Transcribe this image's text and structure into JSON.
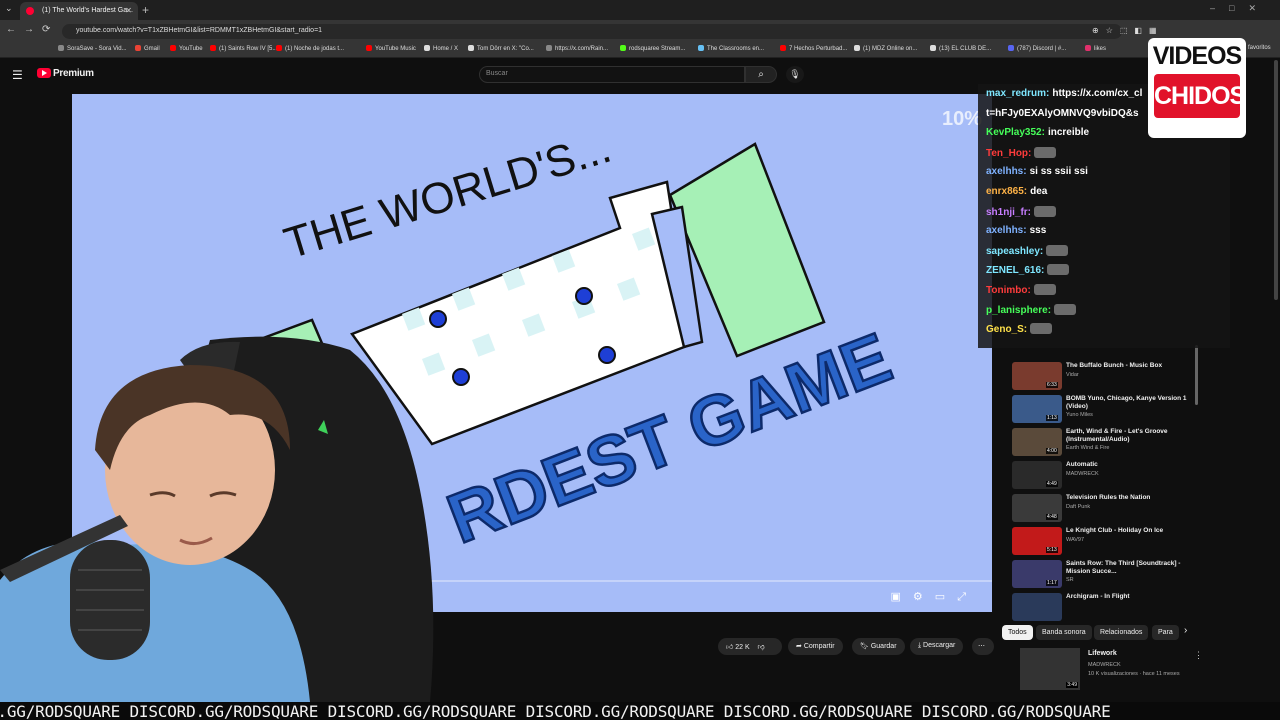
{
  "browser": {
    "tab_title": "(1) The World's Hardest Ga...",
    "url": "youtube.com/watch?v=T1xZBHetmGI&list=RDMMT1xZBHetmGI&start_radio=1",
    "bookmarks": [
      {
        "label": "SoraSave - Sora Vid...",
        "color": "#888888"
      },
      {
        "label": "Gmail",
        "color": "#ea4335"
      },
      {
        "label": "YouTube",
        "color": "#ff0000"
      },
      {
        "label": "(1) Saints Row IV [5...",
        "color": "#ff0000"
      },
      {
        "label": "(1) Noche de jodas t...",
        "color": "#ff0000"
      },
      {
        "label": "YouTube Music",
        "color": "#ff0000"
      },
      {
        "label": "Home / X",
        "color": "#dddddd"
      },
      {
        "label": "Tom Dörr en X: \"Co...",
        "color": "#dddddd"
      },
      {
        "label": "https://x.com/Rain...",
        "color": "#888888"
      },
      {
        "label": "rodsquaree Stream...",
        "color": "#53fc18"
      },
      {
        "label": "The Classrooms en...",
        "color": "#66c0f4"
      },
      {
        "label": "7 Hechos Perturbad...",
        "color": "#ff0000"
      },
      {
        "label": "(1) MDZ Online on...",
        "color": "#dddddd"
      },
      {
        "label": "(13) EL CLUB DE...",
        "color": "#dddddd"
      },
      {
        "label": "(787) Discord | #...",
        "color": "#5865f2"
      },
      {
        "label": "likes",
        "color": "#e1306c"
      }
    ],
    "favorites_label": "favoritos"
  },
  "youtube": {
    "logo_text": "Premium",
    "search_placeholder": "Buscar"
  },
  "player": {
    "overlay_percent": "10%",
    "progress": 0.02,
    "game_title_top": "THE WORLD'S...",
    "game_title_bottom": "RDEST GAME"
  },
  "actions": {
    "likes": "22 K",
    "share": "Compartir",
    "save": "Guardar",
    "download": "Descargar"
  },
  "chat": [
    {
      "user": "max_redrum:",
      "color": "#7fe7ff",
      "text": "https://x.com/cx_cl"
    },
    {
      "user": "",
      "color": "#ffffff",
      "text": "t=hFJy0EXAlyOMNVQ9vbiDQ&s"
    },
    {
      "user": "KevPlay352:",
      "color": "#46ff5a",
      "text": "increible"
    },
    {
      "user": "Ten_Hop:",
      "color": "#ff3c3c",
      "text": ""
    },
    {
      "user": "axelhhs:",
      "color": "#7fb2ff",
      "text": "si ss ssii ssi"
    },
    {
      "user": "enrx865:",
      "color": "#ffb347",
      "text": "dea"
    },
    {
      "user": "sh1nji_fr:",
      "color": "#c77dff",
      "text": ""
    },
    {
      "user": "axelhhs:",
      "color": "#7fb2ff",
      "text": "sss"
    },
    {
      "user": "sapeashley:",
      "color": "#7fe7ff",
      "text": ""
    },
    {
      "user": "ZENEL_616:",
      "color": "#7fe7ff",
      "text": ""
    },
    {
      "user": "Tonimbo:",
      "color": "#ff3c3c",
      "text": ""
    },
    {
      "user": "p_lanisphere:",
      "color": "#46ff5a",
      "text": ""
    },
    {
      "user": "Geno_S:",
      "color": "#ffe14a",
      "text": ""
    }
  ],
  "logo": {
    "line1": "VIDEOS",
    "line2": "CHIDOS"
  },
  "sidebar": {
    "items": [
      {
        "title": "The Buffalo Bunch - Music Box",
        "channel": "Vidar",
        "duration": "6:33",
        "color": "#7a3b2e"
      },
      {
        "title": "BOMB Yuno, Chicago, Kanye Version 1 (Video)",
        "channel": "Yuno Miles",
        "duration": "1:13",
        "color": "#3a5a8a"
      },
      {
        "title": "Earth, Wind & Fire - Let's Groove (Instrumental/Audio)",
        "channel": "Earth Wind & Fire",
        "duration": "4:00",
        "color": "#5a4a3a"
      },
      {
        "title": "Automatic",
        "channel": "MADWRECK",
        "duration": "4:49",
        "color": "#2a2a2a"
      },
      {
        "title": "Television Rules the Nation",
        "channel": "Daft Punk",
        "duration": "4:48",
        "color": "#3a3a3a"
      },
      {
        "title": "Le Knight Club - Holiday On Ice",
        "channel": "WAV97",
        "duration": "5:13",
        "color": "#c21a1a"
      },
      {
        "title": "Saints Row: The Third [Soundtrack] - Mission Succe...",
        "channel": "SR",
        "duration": "1:17",
        "color": "#3a3a6a"
      },
      {
        "title": "Archigram - In Flight",
        "channel": "",
        "duration": "",
        "color": "#2a3a5a"
      }
    ],
    "chips": [
      "Todos",
      "Banda sonora",
      "Relacionados",
      "Para"
    ],
    "next_video": {
      "title": "Lifework",
      "channel": "MADWRECK",
      "meta": "10 K visualizaciones · hace 11 meses",
      "duration": "3:49"
    }
  },
  "ticker": "D.GG/RODSQUARE DISCORD.GG/RODSQUARE DISCORD.GG/RODSQUARE DISCORD.GG/RODSQUARE DISCORD.GG/RODSQUARE DISCORD.GG/RODSQUARE"
}
